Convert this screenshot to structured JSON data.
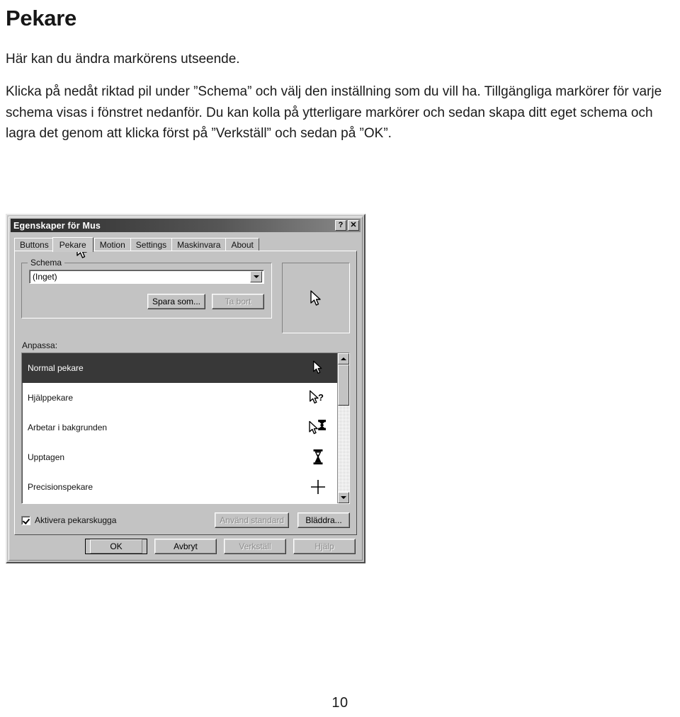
{
  "document": {
    "title": "Pekare",
    "intro": "Här kan du ändra markörens utseende.",
    "paragraph": "Klicka på nedåt riktad pil under ”Schema” och välj den inställning som du vill ha. Tillgängliga markörer för varje schema visas i fönstret nedanför. Du kan kolla på ytterligare markörer och sedan skapa ditt eget schema och lagra det genom att klicka först på ”Verkställ” och sedan på ”OK”.",
    "page_number": "10"
  },
  "dialog": {
    "title": "Egenskaper för Mus",
    "titlebar_buttons": {
      "help": "?",
      "close": "✕"
    },
    "tabs": [
      {
        "label": "Buttons",
        "active": false
      },
      {
        "label": "Pekare",
        "active": true
      },
      {
        "label": "Motion",
        "active": false
      },
      {
        "label": "Settings",
        "active": false
      },
      {
        "label": "Maskinvara",
        "active": false
      },
      {
        "label": "About",
        "active": false
      }
    ],
    "schema_group": {
      "legend": "Schema",
      "combo_value": "(Inget)",
      "save_as_button": "Spara som...",
      "delete_button": "Ta bort",
      "delete_disabled": true
    },
    "preview": {
      "cursor_icon": "arrow-cursor-icon"
    },
    "customize": {
      "label": "Anpassa:",
      "items": [
        {
          "label": "Normal pekare",
          "icon": "arrow-cursor-icon",
          "selected": true
        },
        {
          "label": "Hjälppekare",
          "icon": "arrow-help-cursor-icon",
          "selected": false
        },
        {
          "label": "Arbetar i bakgrunden",
          "icon": "arrow-busy-cursor-icon",
          "selected": false
        },
        {
          "label": "Upptagen",
          "icon": "hourglass-cursor-icon",
          "selected": false
        },
        {
          "label": "Precisionspekare",
          "icon": "crosshair-cursor-icon",
          "selected": false
        }
      ]
    },
    "options": {
      "shadow_checkbox_label": "Aktivera pekarskugga",
      "shadow_checked": true,
      "use_default_button": "Använd standard",
      "use_default_disabled": true,
      "browse_button": "Bläddra..."
    },
    "footer_buttons": [
      {
        "label": "OK",
        "disabled": false,
        "default": true
      },
      {
        "label": "Avbryt",
        "disabled": false,
        "default": false
      },
      {
        "label": "Verkställ",
        "disabled": true,
        "default": false
      },
      {
        "label": "Hjälp",
        "disabled": true,
        "default": false
      }
    ]
  },
  "colors": {
    "dialog_face": "#c3c3c3",
    "selection": "#383838",
    "titlebar_start": "#2b2b2b",
    "text": "#1a1a1a"
  }
}
